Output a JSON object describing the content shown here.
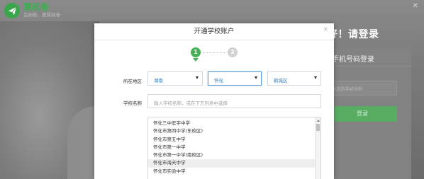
{
  "app": {
    "name": "慧阅卷",
    "tagline": "会阅卷、更慧阅卷",
    "icon": "paper-plane-icon",
    "brand_color": "#3aa64c"
  },
  "window": {
    "close_label": "✕"
  },
  "background_login": {
    "welcome": "好！请登录",
    "panel_title": "手机号码登录",
    "phone_placeholder": "入您的手机号码",
    "login_button": "登录"
  },
  "modal": {
    "title": "开通学校账户",
    "close_label": "×",
    "steps": [
      {
        "number": "1",
        "active": true
      },
      {
        "number": "2",
        "active": false
      }
    ],
    "region": {
      "label": "所在地区",
      "province": "湖南",
      "city": "怀化",
      "district": "鹤城区"
    },
    "school": {
      "label": "学校名称",
      "placeholder": "输入学校名称，或在下方列表中选择",
      "options": [
        "怀化三中宏宇中学",
        "怀化市第四中学(东校区)",
        "怀化市第五中学",
        "怀化市第一中学",
        "怀化市第一中学(南校区)",
        "怀化市海天中学",
        "怀化市实验中学"
      ],
      "hovered_index": 5
    }
  }
}
